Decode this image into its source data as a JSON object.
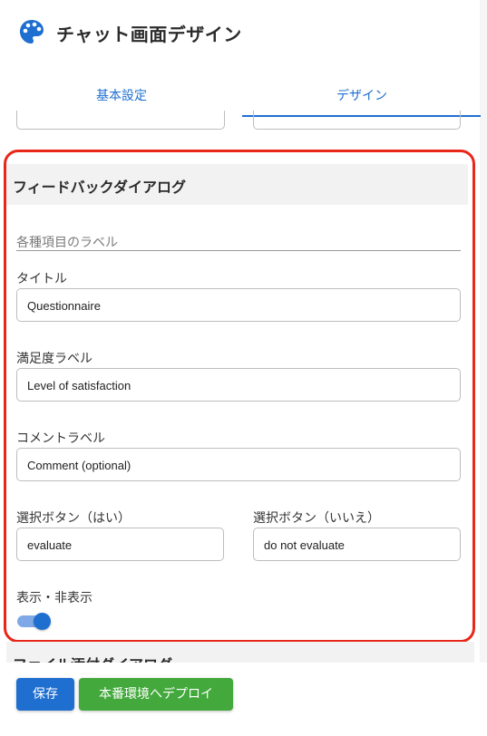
{
  "header": {
    "title": "チャット画面デザイン",
    "icon": "palette-icon"
  },
  "tabs": [
    {
      "label": "基本設定"
    },
    {
      "label": "デザイン"
    }
  ],
  "feedback": {
    "section_title": "フィードバックダイアログ",
    "labels_caption": "各種項目のラベル",
    "fields": {
      "title": {
        "label": "タイトル",
        "value": "Questionnaire"
      },
      "satisfaction": {
        "label": "満足度ラベル",
        "value": "Level of satisfaction"
      },
      "comment": {
        "label": "コメントラベル",
        "value": "Comment (optional)"
      },
      "yes_button": {
        "label": "選択ボタン（はい）",
        "value": "evaluate"
      },
      "no_button": {
        "label": "選択ボタン（いいえ）",
        "value": "do not evaluate"
      }
    },
    "visibility": {
      "label": "表示・非表示",
      "enabled": true
    }
  },
  "next_section": {
    "title": "ファイル添付ダイアログ"
  },
  "footer": {
    "save_label": "保存",
    "deploy_label": "本番環境へデプロイ"
  },
  "colors": {
    "accent": "#1f6fd1",
    "deploy": "#43a93c",
    "highlight": "#e8271a"
  }
}
